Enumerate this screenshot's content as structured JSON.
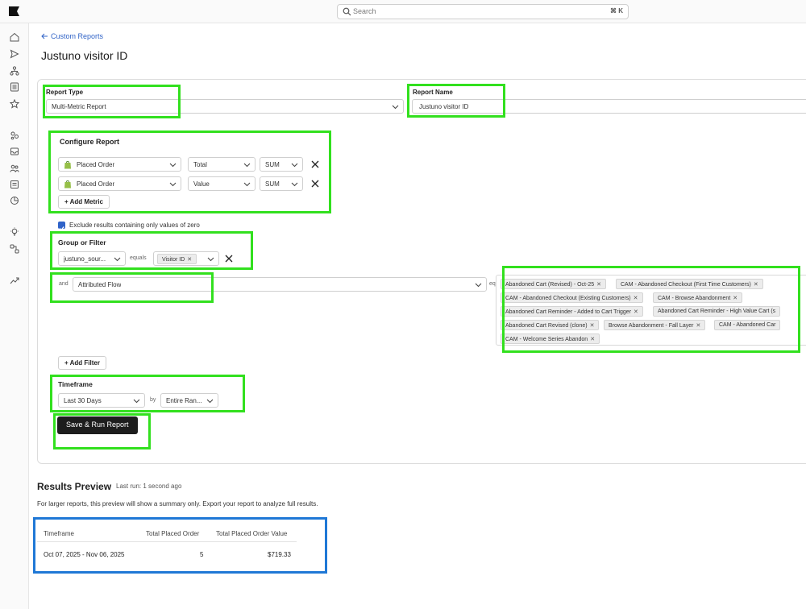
{
  "search": {
    "placeholder": "Search",
    "shortcut": "⌘ K"
  },
  "sidebar_icons": [
    "home-icon",
    "send-icon",
    "flow-icon",
    "list-icon",
    "star-icon",
    "audience-icon",
    "inbox-icon",
    "people-icon",
    "forms-icon",
    "analytics-icon",
    "bulb-icon",
    "integrations-icon",
    "trend-icon"
  ],
  "back_link": "Custom Reports",
  "page_title": "Justuno visitor ID",
  "report_type": {
    "label": "Report Type",
    "value": "Multi-Metric Report"
  },
  "report_name": {
    "label": "Report Name",
    "value": "Justuno visitor ID"
  },
  "configure": {
    "title": "Configure Report",
    "metrics": [
      {
        "metric": "Placed Order",
        "measure": "Total",
        "agg": "SUM"
      },
      {
        "metric": "Placed Order",
        "measure": "Value",
        "agg": "SUM"
      }
    ],
    "add_metric": "+ Add Metric",
    "exclude_zero": "Exclude results containing only values of zero"
  },
  "group_filter": {
    "title": "Group or Filter",
    "group_by": "justuno_sour...",
    "equals": "equals",
    "group_value": "Visitor ID",
    "and": "and",
    "filter_field": "Attributed Flow",
    "filter_equals": "equals",
    "filter_values": [
      "Abandoned Cart (Revised) - Oct-25",
      "CAM - Abandoned Checkout (First Time Customers)",
      "CAM - Abandoned Checkout (Existing Customers)",
      "CAM - Browse Abandonment",
      "Abandoned Cart Reminder - Added to Cart Trigger",
      "Abandoned Cart Reminder - High Value Cart (s",
      "Abandoned Cart Revised (clone)",
      "Browse Abandonment - Fall Layer",
      "CAM - Abandoned Car",
      "CAM - Welcome Series Abandon"
    ],
    "add_filter": "+ Add Filter"
  },
  "timeframe": {
    "title": "Timeframe",
    "value": "Last 30 Days",
    "by": "by",
    "range": "Entire Ran..."
  },
  "run_button": "Save & Run Report",
  "results": {
    "title": "Results Preview",
    "last_run": "Last run: 1 second ago",
    "note": "For larger reports, this preview will show a summary only. Export your report to analyze full results.",
    "columns": [
      "Timeframe",
      "Total Placed Order",
      "Total Placed Order Value"
    ],
    "rows": [
      [
        "Oct 07, 2025 - Nov 06, 2025",
        "5",
        "$719.33"
      ]
    ]
  },
  "colors": {
    "highlight_green": "#32e01e",
    "highlight_blue": "#1f78d6",
    "primary_button": "#1d1d1d",
    "link": "#3164c7",
    "checkbox": "#2f63c9"
  }
}
